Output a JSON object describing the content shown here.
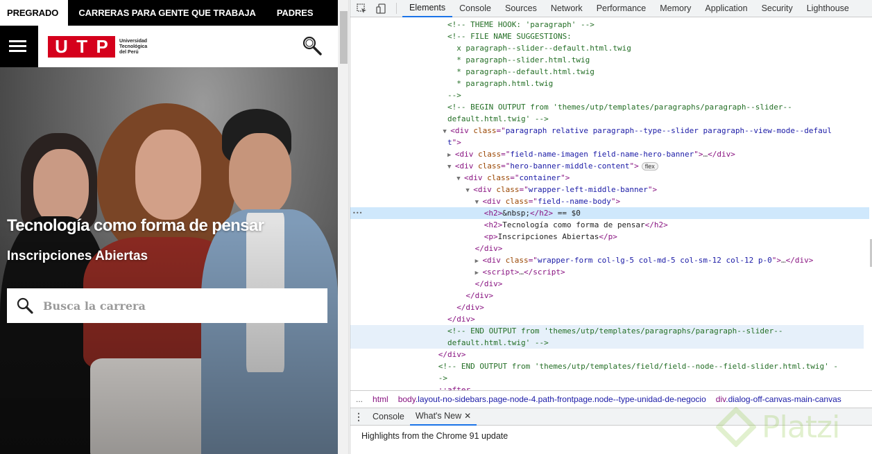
{
  "site": {
    "topnav": [
      "PREGRADO",
      "CARRERAS PARA GENTE QUE TRABAJA",
      "PADRES"
    ],
    "logo": {
      "letters": [
        "U",
        "T",
        "P"
      ],
      "subtitle": "Universidad Tecnológica del Perú",
      "color": "#d5001c"
    },
    "hero": {
      "title": "Tecnología como forma de pensar",
      "subtitle": "Inscripciones Abiertas",
      "search_placeholder": "Busca la carrera"
    }
  },
  "devtools": {
    "tabs": [
      "Elements",
      "Console",
      "Sources",
      "Network",
      "Performance",
      "Memory",
      "Application",
      "Security",
      "Lighthouse"
    ],
    "active_tab": "Elements",
    "dom_lines": [
      {
        "indent": 20,
        "type": "comment",
        "text": "<!-- THEME HOOK: 'paragraph' -->"
      },
      {
        "indent": 20,
        "type": "comment",
        "text": "<!-- FILE NAME SUGGESTIONS:"
      },
      {
        "indent": 22,
        "type": "comment",
        "text": "x paragraph--slider--default.html.twig"
      },
      {
        "indent": 22,
        "type": "comment",
        "text": "* paragraph--slider.html.twig"
      },
      {
        "indent": 22,
        "type": "comment",
        "text": "* paragraph--default.html.twig"
      },
      {
        "indent": 22,
        "type": "comment",
        "text": "* paragraph.html.twig"
      },
      {
        "indent": 20,
        "type": "comment",
        "text": "-->"
      },
      {
        "indent": 20,
        "type": "comment",
        "text": "<!-- BEGIN OUTPUT from 'themes/utp/templates/paragraphs/paragraph--slider--"
      },
      {
        "indent": 20,
        "type": "comment",
        "text": "default.html.twig' -->"
      },
      {
        "indent": 19,
        "type": "open",
        "tri": "▼",
        "tag": "div",
        "attr": "class",
        "val": "paragraph relative paragraph--type--slider paragraph--view-mode--defaul"
      },
      {
        "indent": 20,
        "type": "cont",
        "text": "t\">"
      },
      {
        "indent": 20,
        "type": "collapsed",
        "tri": "▶",
        "tag": "div",
        "attr": "class",
        "val": "field-name-imagen field-name-hero-banner"
      },
      {
        "indent": 20,
        "type": "open",
        "tri": "▼",
        "tag": "div",
        "attr": "class",
        "val": "hero-banner-middle-content",
        "badge": "flex"
      },
      {
        "indent": 22,
        "type": "open",
        "tri": "▼",
        "tag": "div",
        "attr": "class",
        "val": "container"
      },
      {
        "indent": 24,
        "type": "open",
        "tri": "▼",
        "tag": "div",
        "attr": "class",
        "val": "wrapper-left-middle-banner"
      },
      {
        "indent": 26,
        "type": "open",
        "tri": "▼",
        "tag": "div",
        "attr": "class",
        "val": "field--name-body"
      },
      {
        "indent": 28,
        "type": "selected",
        "text": "<h2>&nbsp;</h2>",
        "eq": " == $0"
      },
      {
        "indent": 28,
        "type": "element",
        "tag": "h2",
        "inner": "Tecnología como forma de pensar"
      },
      {
        "indent": 28,
        "type": "element",
        "tag": "p",
        "inner": "Inscripciones Abiertas"
      },
      {
        "indent": 26,
        "type": "close",
        "tag": "div"
      },
      {
        "indent": 26,
        "type": "collapsed",
        "tri": "▶",
        "tag": "div",
        "attr": "class",
        "val": "wrapper-form col-lg-5 col-md-5 col-sm-12 col-12 p-0"
      },
      {
        "indent": 26,
        "type": "collapsedscript",
        "tri": "▶",
        "tag": "script"
      },
      {
        "indent": 26,
        "type": "close",
        "tag": "div"
      },
      {
        "indent": 24,
        "type": "close",
        "tag": "div"
      },
      {
        "indent": 22,
        "type": "close",
        "tag": "div"
      },
      {
        "indent": 20,
        "type": "close",
        "tag": "div"
      },
      {
        "indent": 20,
        "type": "comment",
        "text": "<!-- END OUTPUT from 'themes/utp/templates/paragraphs/paragraph--slider--"
      },
      {
        "indent": 20,
        "type": "comment",
        "text": "default.html.twig' -->"
      },
      {
        "indent": 18,
        "type": "close",
        "tag": "div"
      },
      {
        "indent": 18,
        "type": "comment",
        "text": "<!-- END OUTPUT from 'themes/utp/templates/field/field--node--field-slider.html.twig' -"
      },
      {
        "indent": 18,
        "type": "comment",
        "text": "->"
      },
      {
        "indent": 18,
        "type": "pseudo",
        "text": "::after"
      }
    ],
    "breadcrumbs": [
      {
        "tag": "...",
        "cls": ""
      },
      {
        "tag": "html",
        "cls": ""
      },
      {
        "tag": "body",
        "cls": ".layout-no-sidebars.page-node-4.path-frontpage.node--type-unidad-de-negocio"
      },
      {
        "tag": "div",
        "cls": ".dialog-off-canvas-main-canvas"
      }
    ],
    "drawer": {
      "tabs": [
        "Console",
        "What's New"
      ],
      "active_tab": "What's New",
      "message": "Highlights from the Chrome 91 update"
    }
  },
  "watermark": "Platzi"
}
